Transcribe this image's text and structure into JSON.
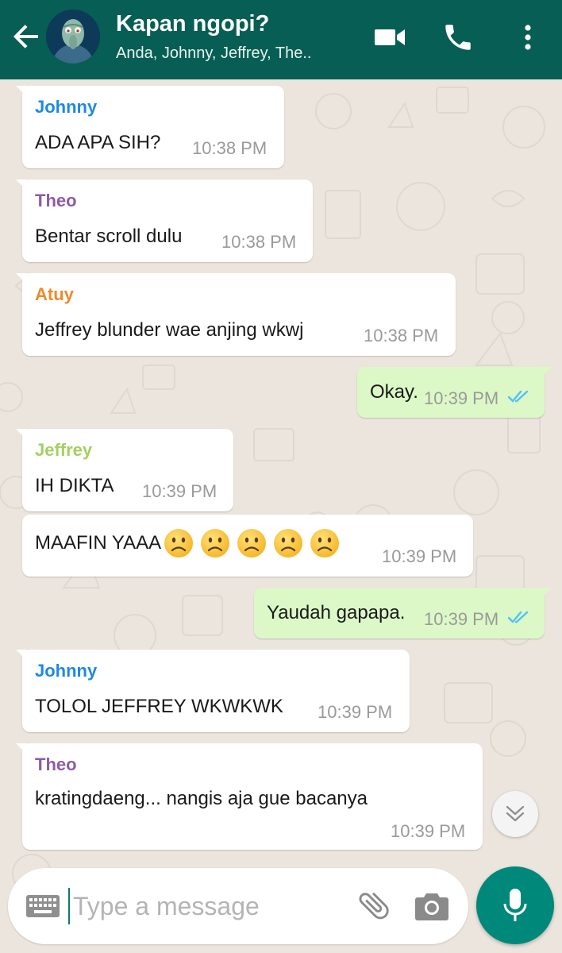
{
  "header": {
    "title": "Kapan ngopi?",
    "subtitle": "Anda, Johnny, Jeffrey, The..",
    "icons": [
      "back-arrow-icon",
      "video-call-icon",
      "phone-icon",
      "more-vert-icon"
    ]
  },
  "messages": [
    {
      "direction": "in",
      "sender": "Johnny",
      "sender_color": "#1e88e5",
      "text": "ADA APA SIH?",
      "time": "10:38 PM"
    },
    {
      "direction": "in",
      "sender": "Theo",
      "sender_color": "#8e5ba6",
      "text": "Bentar scroll dulu",
      "time": "10:38 PM"
    },
    {
      "direction": "in",
      "sender": "Atuy",
      "sender_color": "#ef8a2a",
      "text": "Jeffrey blunder wae anjing wkwj",
      "time": "10:38 PM"
    },
    {
      "direction": "out",
      "text": "Okay.",
      "time": "10:39 PM",
      "status": "read"
    },
    {
      "direction": "in",
      "sender": "Jeffrey",
      "sender_color": "#a5cf63",
      "text": "IH DIKTA",
      "time": "10:39 PM"
    },
    {
      "direction": "in",
      "text": "MAAFIN YAAA",
      "emoji": [
        "slightly-frowning-face",
        "slightly-frowning-face",
        "slightly-frowning-face",
        "slightly-frowning-face",
        "slightly-frowning-face"
      ],
      "time": "10:39 PM"
    },
    {
      "direction": "out",
      "text": "Yaudah gapapa.",
      "time": "10:39 PM",
      "status": "read"
    },
    {
      "direction": "in",
      "sender": "Johnny",
      "sender_color": "#1e88e5",
      "text": "TOLOL JEFFREY WKWKWK",
      "time": "10:39 PM"
    },
    {
      "direction": "in",
      "sender": "Theo",
      "sender_color": "#8e5ba6",
      "text": "kratingdaeng... nangis aja gue bacanya",
      "time": "10:39 PM"
    }
  ],
  "composer": {
    "placeholder": "Type a message",
    "icons": [
      "keyboard-icon",
      "attach-icon",
      "camera-icon",
      "mic-icon"
    ]
  },
  "colors": {
    "header": "#075e54",
    "outgoing_bubble": "#dcf8c6",
    "incoming_bubble": "#ffffff",
    "read_ticks": "#4fc3f7",
    "mic_button": "#00897b"
  }
}
